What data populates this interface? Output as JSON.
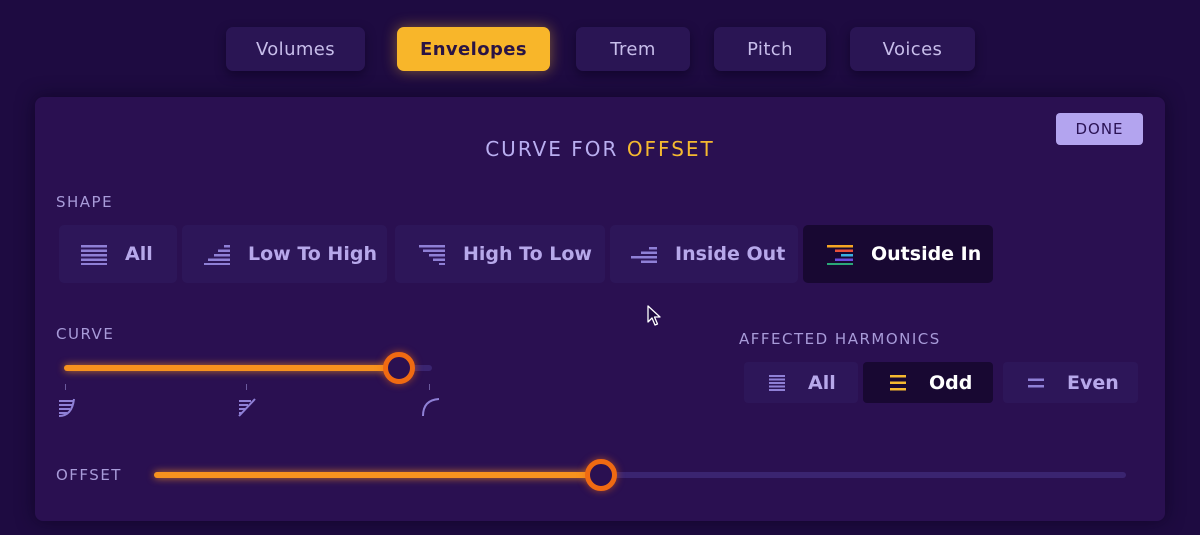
{
  "tabs": [
    {
      "label": "Volumes",
      "active": false
    },
    {
      "label": "Envelopes",
      "active": true
    },
    {
      "label": "Trem",
      "active": false
    },
    {
      "label": "Pitch",
      "active": false
    },
    {
      "label": "Voices",
      "active": false
    }
  ],
  "panel": {
    "done_label": "DONE",
    "title_prefix": "CURVE FOR",
    "title_param": "OFFSET",
    "shape": {
      "label": "SHAPE",
      "options": [
        {
          "label": "All",
          "icon": "all-lines-icon",
          "selected": false
        },
        {
          "label": "Low To High",
          "icon": "low-to-high-icon",
          "selected": false
        },
        {
          "label": "High To Low",
          "icon": "high-to-low-icon",
          "selected": false
        },
        {
          "label": "Inside Out",
          "icon": "inside-out-icon",
          "selected": false
        },
        {
          "label": "Outside In",
          "icon": "outside-in-icon",
          "selected": true
        }
      ]
    },
    "curve": {
      "label": "CURVE",
      "value_fraction": 0.91,
      "marker_icons": [
        "convex-curve-icon",
        "linear-curve-icon",
        "concave-curve-icon"
      ]
    },
    "harmonics": {
      "label": "AFFECTED HARMONICS",
      "options": [
        {
          "label": "All",
          "icon": "all-harmonics-icon",
          "selected": false
        },
        {
          "label": "Odd",
          "icon": "odd-harmonics-icon",
          "selected": true
        },
        {
          "label": "Even",
          "icon": "even-harmonics-icon",
          "selected": false
        }
      ]
    },
    "offset": {
      "label": "OFFSET",
      "value_fraction": 0.46
    }
  },
  "colors": {
    "background": "#1e0b41",
    "panel": "#2a1051",
    "accent_yellow": "#f8b62a",
    "slider_fill": "#f7921e",
    "thumb_ring": "#f06a12",
    "button_lavender": "#b3a4ef"
  }
}
